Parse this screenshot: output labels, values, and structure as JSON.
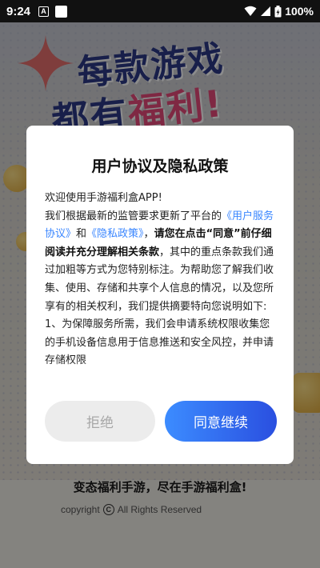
{
  "status_bar": {
    "time": "9:24",
    "notif_a": "A",
    "battery": "100%"
  },
  "background": {
    "banner_line1": "每款游戏",
    "banner_line2_prefix": "都有",
    "banner_line2_hot": "福利!",
    "slogan": "变态福利手游，尽在手游福利盒!",
    "copyright_prefix": "copyright",
    "copyright_mark": "C",
    "copyright_suffix": "All Rights Reserved"
  },
  "dialog": {
    "title": "用户协议及隐私政策",
    "p1": "欢迎使用手游福利盒APP!",
    "p2_a": "我们根据最新的监管要求更新了平台的",
    "p2_link1": "《用户服务协议》",
    "p2_and": "和",
    "p2_link2": "《隐私政策》",
    "p2_comma": "，",
    "p2_bold": "请您在点击“同意”前仔细阅读并充分理解相关条款",
    "p2_b": "，其中的重点条款我们通过加粗等方式为您特别标注。为帮助您了解我们收集、使用、存储和共享个人信息的情况，以及您所享有的相关权利，我们提供摘要特向您说明如下:",
    "p3": "1、为保障服务所需，我们会申请系统权限收集您的手机设备信息用于信息推送和安全风控，并申请存储权限",
    "reject_label": "拒绝",
    "accept_label": "同意继续"
  },
  "colors": {
    "accent": "#3a86ff",
    "button_gradient_start": "#3c8cff",
    "button_gradient_end": "#2a4fe0",
    "banner_blue": "#2d3a87",
    "banner_pink": "#e84a7a"
  }
}
